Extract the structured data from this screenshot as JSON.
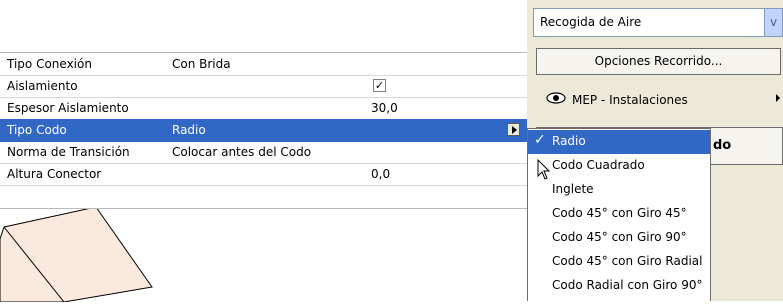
{
  "properties": {
    "rows": [
      {
        "label": "Tipo Conexión",
        "value": "Con Brida"
      },
      {
        "label": "Aislamiento",
        "checkbox": "☑"
      },
      {
        "label": "Espesor Aislamiento",
        "number": "30,0"
      },
      {
        "label": "Tipo Codo",
        "value": "Radio",
        "selected": true
      },
      {
        "label": "Norma de Transición",
        "value": "Colocar antes del Codo"
      },
      {
        "label": "Altura Conector",
        "number": "0,0"
      }
    ],
    "check_mark": "✓"
  },
  "panel": {
    "route_select": {
      "value": "Recogida de Aire",
      "arrow": "v"
    },
    "route_options_button": "Opciones Recorrido...",
    "layer": {
      "label": "MEP - Instalaciones",
      "icon": "eye-icon"
    },
    "partial_button_label": "do"
  },
  "dropdown": {
    "items": [
      "Radio",
      "Codo Cuadrado",
      "Inglete",
      "Codo 45° con Giro 45°",
      "Codo 45° con Giro 90°",
      "Codo 45° con Giro Radial",
      "Codo Radial con Giro 90°"
    ],
    "selected_index": 0,
    "check_glyph": "✓"
  },
  "colors": {
    "selection": "#3168c6",
    "panel_bg": "#ece9d8",
    "shape_fill": "#fbe9dd"
  }
}
